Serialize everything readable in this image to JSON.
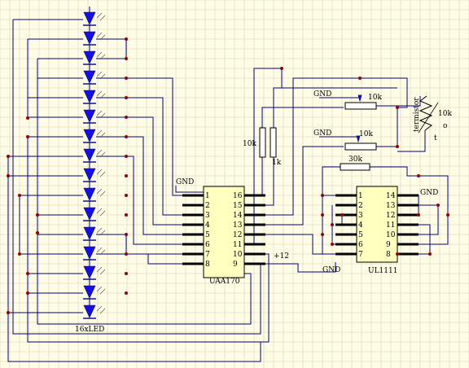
{
  "colors": {
    "background": "#fffde6",
    "grid": "#d6d3b8",
    "wire": "#000080",
    "led": "#1010ee",
    "ic_body": "#ffffc0",
    "pin": "#000000",
    "junction": "#9a0000"
  },
  "labels": {
    "led_array": "16xLED",
    "uaa170": "UAA170",
    "ul1111": "UL1111",
    "gnd_uaa": "GND",
    "gnd_pot1": "GND",
    "gnd_pot2": "GND",
    "gnd_ul_right": "GND",
    "gnd_ul_bottom": "GND",
    "plus12": "+12",
    "r10k_left": "10k",
    "r1k": "1k",
    "pot1_value": "10k",
    "pot2_value": "10k",
    "r30k": "30k",
    "thermistor": "termistor",
    "thermistor_value": "10k",
    "thermistor_symbol": "t",
    "thermistor_degree": "o"
  },
  "uaa170": {
    "left_pins": [
      "1",
      "2",
      "3",
      "4",
      "5",
      "6",
      "7",
      "8"
    ],
    "right_pins": [
      "16",
      "15",
      "14",
      "13",
      "12",
      "11",
      "10",
      "9"
    ]
  },
  "ul1111": {
    "left_pins": [
      "1",
      "2",
      "3",
      "4",
      "5",
      "6",
      "7"
    ],
    "right_pins": [
      "14",
      "13",
      "12",
      "11",
      "10",
      "9",
      "8"
    ]
  }
}
